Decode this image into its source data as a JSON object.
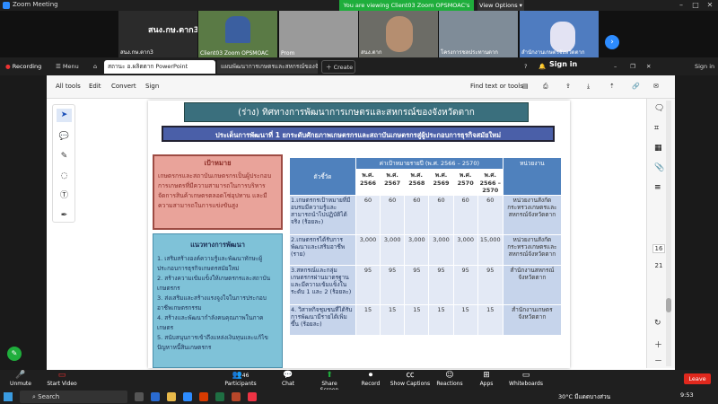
{
  "window": {
    "title": "Zoom Meeting",
    "viewing": "You are viewing Client03 Zoom OPSMOAC's screen",
    "view_options": "View Options"
  },
  "gallery": {
    "name_tile": "สนง.กษ.ตาก3",
    "tiles": [
      {
        "label": "สนง.กษ.ตาก3"
      },
      {
        "label": "Client03 Zoom OPSMOAC"
      },
      {
        "label": "Prom"
      },
      {
        "label": "สนง.ตาก"
      },
      {
        "label": "โครงการชลประทานตาก"
      },
      {
        "label": "สำนักงานเกษตรจังหวัดตาก"
      }
    ]
  },
  "browser": {
    "recording": "Recording",
    "tab1": "สถานะ อ.ผลิตตาก PowerPoint",
    "tab2": "แผนพัฒนาการเกษตรและสหกรณ์ของจังหวัดตาก",
    "create": "Create",
    "menu": "Menu",
    "sign_in": "Sign in"
  },
  "acrobat": {
    "menus": [
      "All tools",
      "Edit",
      "Convert",
      "Sign"
    ],
    "find": "Find text or tools",
    "page_num": "16",
    "page_total": "21"
  },
  "slide": {
    "title": "(ร่าง)  ทิศทางการพัฒนาการเกษตรและสหกรณ์ของจังหวัดตาก",
    "subtitle": "ประเด็นการพัฒนาที่ 1 ยกระดับศักยภาพเกษตรกรและสถาบันเกษตรกรสู่ผู้ประกอบการธุรกิจสมัยใหม่",
    "goal_heading": "เป้าหมาย",
    "goal_text": "เกษตรกรและสถาบันเกษตรกรเป็นผู้ประกอบการเกษตรที่มีความสามารถในการบริหารจัดการสินค้าเกษตรตลอดโซ่อุปทาน และมีความสามารถในการแข่งขันสูง",
    "approach_heading": "แนวทางการพัฒนา",
    "approaches": [
      "1. เสริมสร้างองค์ความรู้และพัฒนาทักษะผู้ประกอบการธุรกิจเกษตรสมัยใหม่",
      "2. สร้างความเข้มแข็งให้เกษตรกรและสถาบันเกษตรกร",
      "3. ส่งเสริมและสร้างแรงจูงใจในการประกอบอาชีพเกษตรกรรม",
      "4. สร้างและพัฒนากำลังคนคุณภาพในภาคเกษตร",
      "5. สนับสนุนการเข้าถึงแหล่งเงินทุนและแก้ไขปัญหาหนี้สินเกษตรกร"
    ],
    "table": {
      "col_indicator": "ตัวชี้วัด",
      "col_target": "ค่าเป้าหมายรายปี (พ.ศ. 2566 – 2570)",
      "col_agency": "หน่วยงาน",
      "years": [
        "พ.ศ. 2566",
        "พ.ศ. 2567",
        "พ.ศ. 2568",
        "พ.ศ. 2569",
        "พ.ศ. 2570",
        "พ.ศ. 2566 – 2570"
      ],
      "rows": [
        {
          "indicator": "1.เกษตรกรเป้าหมายที่มีอบรมมีความรู้และสามารถนำไปปฏิบัติได้จริง (ร้อยละ)",
          "values": [
            "60",
            "60",
            "60",
            "60",
            "60",
            "60"
          ],
          "agency": "หน่วยงานสังกัดกระทรวงเกษตรและสหกรณ์จังหวัดตาก"
        },
        {
          "indicator": "2.เกษตรกรได้รับการพัฒนาและเสริมอาชีพ (ราย)",
          "values": [
            "3,000",
            "3,000",
            "3,000",
            "3,000",
            "3,000",
            "15,000"
          ],
          "agency": "หน่วยงานสังกัดกระทรวงเกษตรและสหกรณ์จังหวัดตาก"
        },
        {
          "indicator": "3.สหกรณ์และกลุ่มเกษตรกรผ่านมาตรฐานและมีความเข้มแข็งในระดับ 1 และ 2 (ร้อยละ)",
          "values": [
            "95",
            "95",
            "95",
            "95",
            "95",
            "95"
          ],
          "agency": "สำนักงานสหกรณ์จังหวัดตาก"
        },
        {
          "indicator": "4. วิสาหกิจชุมชนที่ได้รับการพัฒนามีรายได้เพิ่มขึ้น (ร้อยละ)",
          "values": [
            "15",
            "15",
            "15",
            "15",
            "15",
            "15"
          ],
          "agency": "สำนักงานเกษตรจังหวัดตาก"
        }
      ]
    }
  },
  "toolbar": {
    "unmute": "Unmute",
    "start_video": "Start Video",
    "participants": "Participants",
    "participants_count": "46",
    "chat": "Chat",
    "share": "Share Screen",
    "record": "Record",
    "captions": "Show Captions",
    "reactions": "Reactions",
    "apps": "Apps",
    "whiteboards": "Whiteboards",
    "leave": "Leave"
  },
  "taskbar": {
    "search": "Search",
    "weather": "30°C มีแดดบางส่วน",
    "time": "9:53"
  },
  "colors": {
    "banner": "#3a6f7d",
    "subbanner": "#4a5fa8",
    "goal": "#e9a39a",
    "approach": "#7fc2d8",
    "table_header": "#4f81bd",
    "share_green": "#1fae3c",
    "leave": "#e0281d"
  }
}
